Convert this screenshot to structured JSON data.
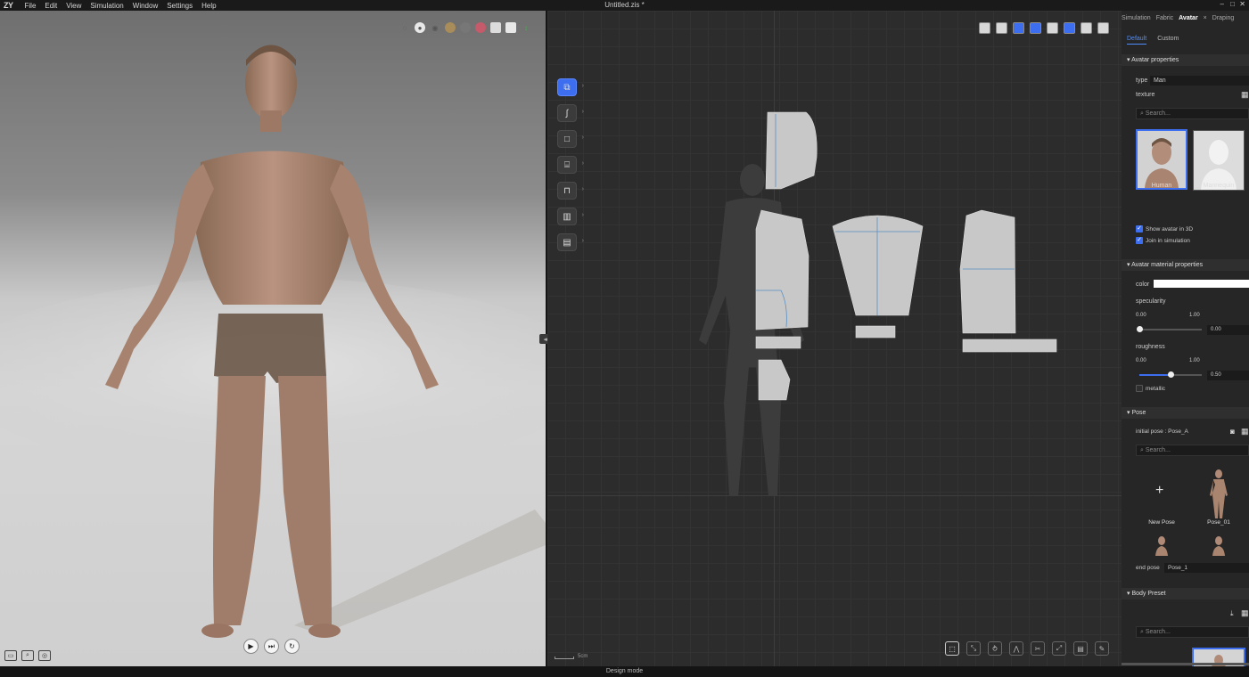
{
  "app": {
    "logo": "ZY",
    "menus": [
      "File",
      "Edit",
      "View",
      "Simulation",
      "Window",
      "Settings",
      "Help"
    ],
    "document_title": "Untitled.zis *",
    "window_controls": [
      "–",
      "□",
      "✕"
    ]
  },
  "viewport": {
    "play_controls": [
      "▶",
      "⏭",
      "↻"
    ]
  },
  "pattern_window": {
    "scale_label": "5cm"
  },
  "status_bar": {
    "mode": "Design mode"
  },
  "right_panel": {
    "tabs": [
      "Simulation",
      "Fabric",
      "Avatar",
      "×",
      "Draping"
    ],
    "active_tab": "Avatar",
    "subtabs": [
      "Default",
      "Custom"
    ],
    "avatar_properties": {
      "header": "Avatar properties",
      "type_label": "type",
      "type_value": "Man",
      "texture_label": "texture",
      "search_placeholder": "Search...",
      "options": [
        "Human",
        "Mannequin"
      ],
      "selected": "Human",
      "show_avatar_label": "Show avatar in 3D",
      "join_sim_label": "Join in simulation"
    },
    "material": {
      "header": "Avatar material properties",
      "color_label": "color",
      "color_value": "#ffffff",
      "specularity_label": "specularity",
      "spec_min": "0.00",
      "spec_max": "1.00",
      "spec_value": "0.00",
      "spec_fraction": 0.0,
      "roughness_label": "roughness",
      "rough_min": "0.00",
      "rough_max": "1.00",
      "rough_value": "0.50",
      "rough_fraction": 0.5,
      "metallic_label": "metallic"
    },
    "pose": {
      "header": "Pose",
      "initial_pose": "initial pose : Pose_A",
      "search_placeholder": "Search...",
      "new_pose_label": "New Pose",
      "pose_01_label": "Pose_01",
      "end_pose_label": "end pose",
      "end_pose_value": "Pose_1"
    },
    "body_preset": {
      "header": "Body Preset",
      "search_placeholder": "Search..."
    }
  }
}
